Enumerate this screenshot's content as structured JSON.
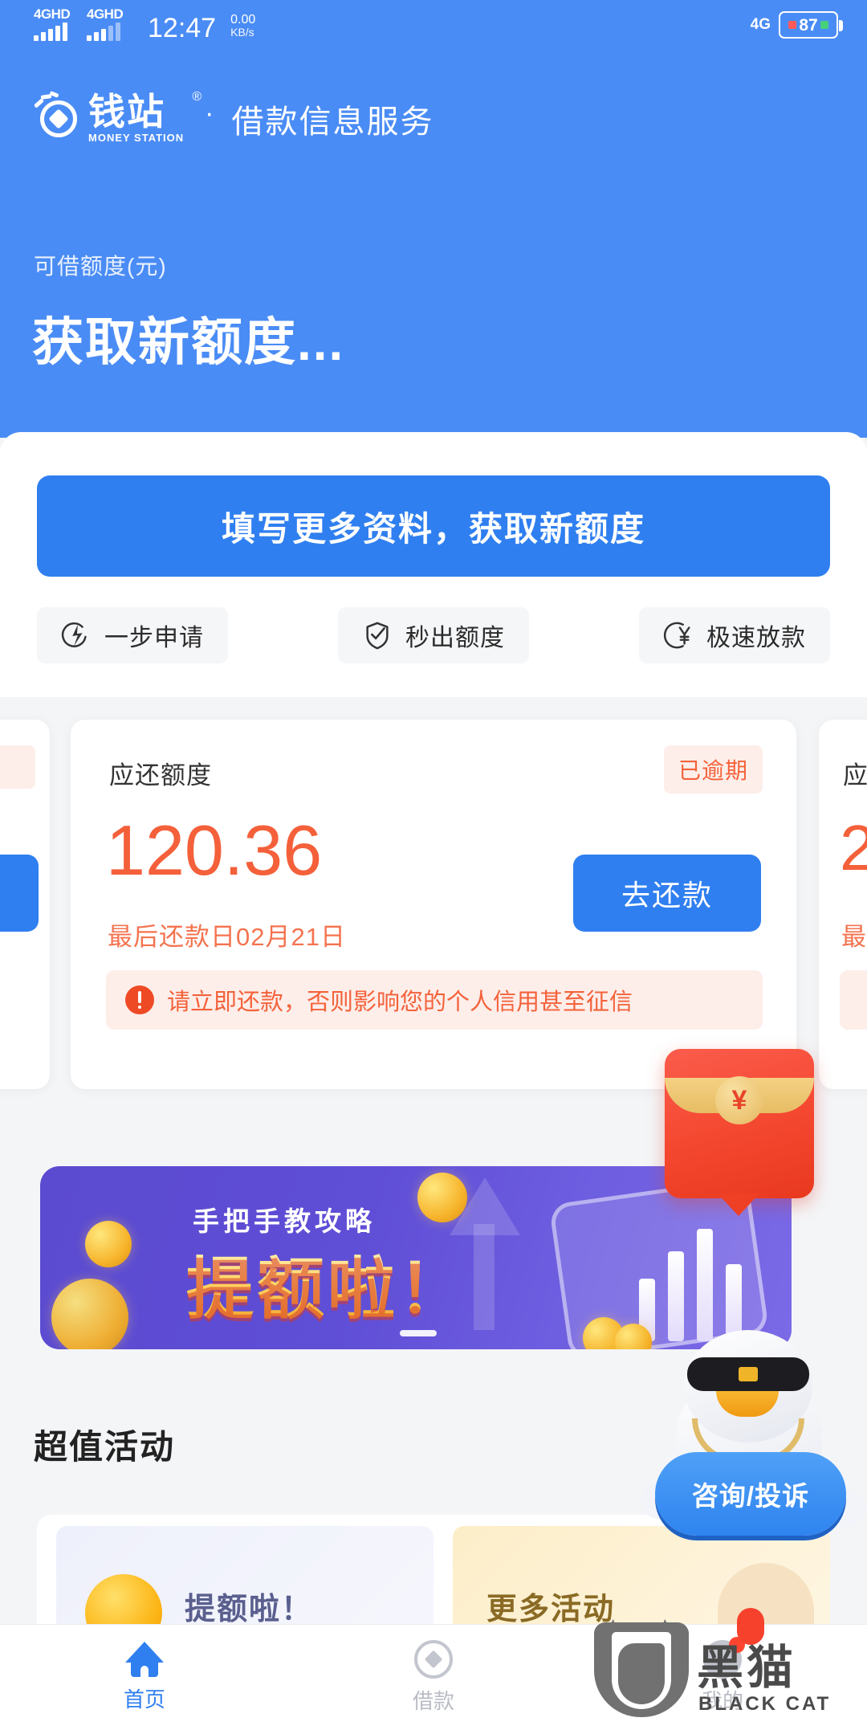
{
  "statusbar": {
    "network_1": "4GHD",
    "network_2": "4GHD",
    "clock": "12:47",
    "speed_value": "0.00",
    "speed_unit": "KB/s",
    "network_right": "4G",
    "battery": "87"
  },
  "header": {
    "brand_cn": "钱站",
    "brand_reg": "®",
    "brand_en": "MONEY STATION",
    "separator": "·",
    "subtitle": "借款信息服务",
    "limit_label": "可借额度(元)",
    "limit_value": "获取新额度..."
  },
  "panel": {
    "cta_label": "填写更多资料，获取新额度",
    "pills": [
      {
        "label": "一步申请",
        "icon": "lightning-circle-icon"
      },
      {
        "label": "秒出额度",
        "icon": "shield-check-icon"
      },
      {
        "label": "极速放款",
        "icon": "yen-circle-icon"
      }
    ]
  },
  "repay_card": {
    "head": "应还额度",
    "badge": "已逾期",
    "amount": "120.36",
    "date": "最后还款日02月21日",
    "button": "去还款",
    "warning": "请立即还款，否则影响您的个人信用甚至征信"
  },
  "repay_card_right": {
    "head": "应",
    "date": "最"
  },
  "banner": {
    "title": "手把手教攻略",
    "headline": "提额啦！"
  },
  "activities": {
    "section_title": "超值活动",
    "items": [
      {
        "label": "提额啦！"
      },
      {
        "label": "更多活动"
      }
    ]
  },
  "floaters": {
    "redpacket_symbol": "¥",
    "mascot_label": "咨询/投诉"
  },
  "tabbar": {
    "items": [
      {
        "label": "首页",
        "icon": "home-icon",
        "active": true
      },
      {
        "label": "借款",
        "icon": "diamond-circle-icon",
        "active": false
      },
      {
        "label": "我的",
        "icon": "person-icon",
        "active": false
      }
    ]
  },
  "watermark": {
    "title": "黑猫",
    "subtitle": "BLACK CAT",
    "ghost": "我的"
  },
  "colors": {
    "brand_blue": "#4a8cf5",
    "cta_blue": "#2f7ff0",
    "alert_red": "#f4603a",
    "alert_bg": "#fdeeea",
    "page_bg": "#f4f5f7",
    "banner_purple": "#5b4bd0"
  }
}
